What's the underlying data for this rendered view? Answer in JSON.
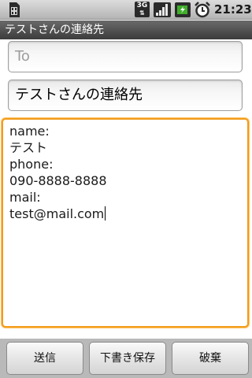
{
  "status_bar": {
    "time": "21:23",
    "network_badge": "3G",
    "icons": [
      "sim-card-icon",
      "3g-icon",
      "signal-icon",
      "battery-charging-icon",
      "alarm-clock-icon"
    ]
  },
  "title_bar": {
    "title": "テストさんの連絡先"
  },
  "compose": {
    "to_placeholder": "To",
    "subject_value": "テストさんの連絡先",
    "body_lines": [
      "name:",
      "テスト",
      "phone:",
      "090-8888-8888",
      "mail:",
      "test@mail.com"
    ]
  },
  "buttons": {
    "send": "送信",
    "save_draft": "下書き保存",
    "discard": "破棄"
  },
  "colors": {
    "focus_border": "#f29c1c",
    "titlebar": "#4a4a4a",
    "battery_green": "#3fae2a"
  }
}
